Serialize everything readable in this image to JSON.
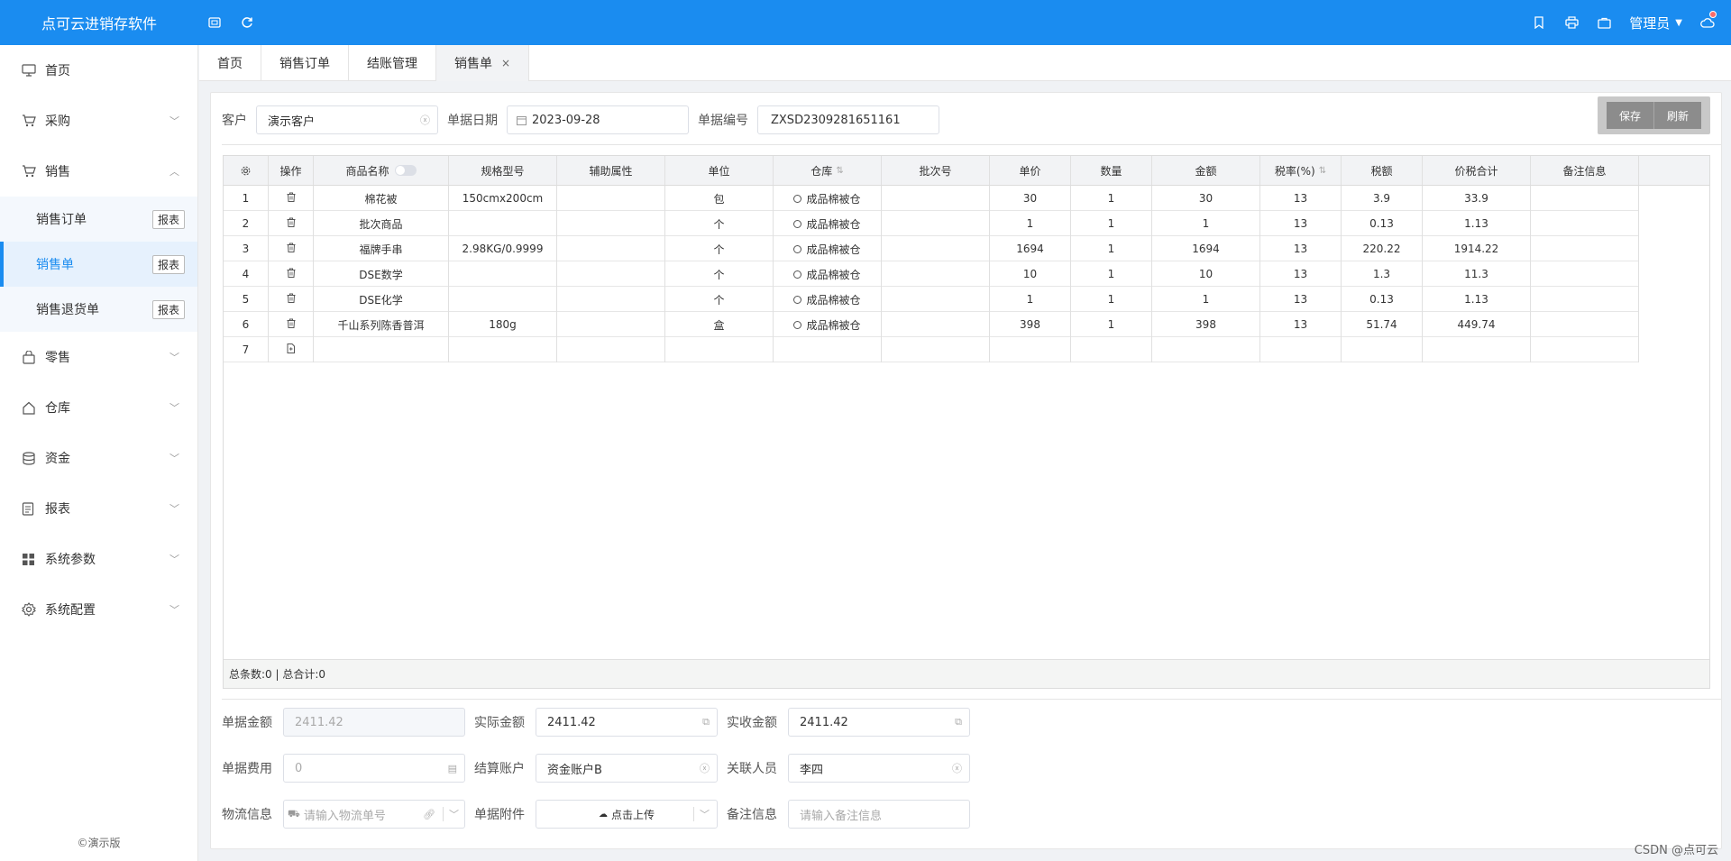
{
  "app": {
    "title": "点可云进销存软件"
  },
  "topbar": {
    "user": "管理员"
  },
  "sidebar": {
    "items": [
      {
        "label": "首页",
        "icon": "monitor-icon"
      },
      {
        "label": "采购",
        "icon": "cart-icon"
      },
      {
        "label": "销售",
        "icon": "cart-icon"
      },
      {
        "label": "零售",
        "icon": "bag-icon"
      },
      {
        "label": "仓库",
        "icon": "home-icon"
      },
      {
        "label": "资金",
        "icon": "database-icon"
      },
      {
        "label": "报表",
        "icon": "report-icon"
      },
      {
        "label": "系统参数",
        "icon": "grid-icon"
      },
      {
        "label": "系统配置",
        "icon": "gear-icon"
      }
    ],
    "sub": [
      {
        "label": "销售订单",
        "btn": "报表"
      },
      {
        "label": "销售单",
        "btn": "报表"
      },
      {
        "label": "销售退货单",
        "btn": "报表"
      }
    ],
    "footer": "©演示版"
  },
  "tabs": [
    {
      "label": "首页"
    },
    {
      "label": "销售订单"
    },
    {
      "label": "结账管理"
    },
    {
      "label": "销售单",
      "close": "×"
    }
  ],
  "form": {
    "customer_label": "客户",
    "customer": "演示客户",
    "date_label": "单据日期",
    "date": "2023-09-28",
    "number_label": "单据编号",
    "number": "ZXSD2309281651161",
    "save": "保存",
    "refresh": "刷新"
  },
  "table": {
    "headers": [
      "",
      "操作",
      "商品名称",
      "规格型号",
      "辅助属性",
      "单位",
      "仓库",
      "批次号",
      "单价",
      "数量",
      "金额",
      "税率(%)",
      "税额",
      "价税合计",
      "备注信息"
    ],
    "rows": [
      [
        "1",
        "",
        "棉花被",
        "150cmx200cm",
        "",
        "包",
        "成品棉被仓",
        "",
        "30",
        "1",
        "30",
        "13",
        "3.9",
        "33.9",
        ""
      ],
      [
        "2",
        "",
        "批次商品",
        "",
        "",
        "个",
        "成品棉被仓",
        "",
        "1",
        "1",
        "1",
        "13",
        "0.13",
        "1.13",
        ""
      ],
      [
        "3",
        "",
        "福牌手串",
        "2.98KG/0.9999",
        "",
        "个",
        "成品棉被仓",
        "",
        "1694",
        "1",
        "1694",
        "13",
        "220.22",
        "1914.22",
        ""
      ],
      [
        "4",
        "",
        "DSE数学",
        "",
        "",
        "个",
        "成品棉被仓",
        "",
        "10",
        "1",
        "10",
        "13",
        "1.3",
        "11.3",
        ""
      ],
      [
        "5",
        "",
        "DSE化学",
        "",
        "",
        "个",
        "成品棉被仓",
        "",
        "1",
        "1",
        "1",
        "13",
        "0.13",
        "1.13",
        ""
      ],
      [
        "6",
        "",
        "千山系列陈香普洱",
        "180g",
        "",
        "盒",
        "成品棉被仓",
        "",
        "398",
        "1",
        "398",
        "13",
        "51.74",
        "449.74",
        ""
      ],
      [
        "7",
        "",
        "",
        "",
        "",
        "",
        "",
        "",
        "",
        "",
        "",
        "",
        "",
        "",
        ""
      ]
    ],
    "summary": "总条数:0 | 总合计:0"
  },
  "footer_form": {
    "bill_amount_label": "单据金额",
    "bill_amount": "2411.42",
    "actual_amount_label": "实际金额",
    "actual_amount": "2411.42",
    "received_label": "实收金额",
    "received": "2411.42",
    "fee_label": "单据费用",
    "fee": "0",
    "account_label": "结算账户",
    "account": "资金账户B",
    "person_label": "关联人员",
    "person": "李四",
    "logistics_label": "物流信息",
    "logistics_ph": "请输入物流单号",
    "attach_label": "单据附件",
    "attach_btn": "点击上传",
    "remark_label": "备注信息",
    "remark_ph": "请输入备注信息"
  },
  "watermark": "CSDN @点可云"
}
